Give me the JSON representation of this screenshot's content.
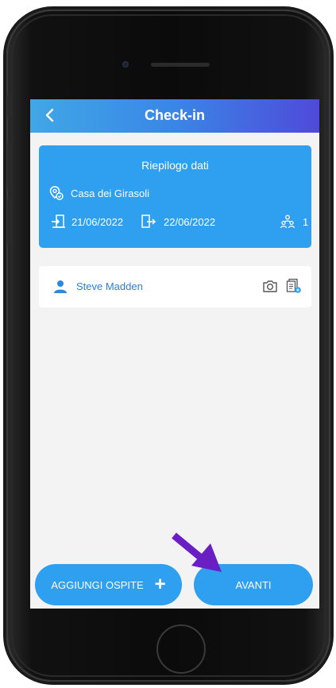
{
  "header": {
    "title": "Check-in",
    "back_icon": "chevron-left-icon"
  },
  "summary": {
    "heading": "Riepilogo dati",
    "property_name": "Casa dei Girasoli",
    "checkin_date": "21/06/2022",
    "checkout_date": "22/06/2022",
    "guest_count": "1"
  },
  "guests": [
    {
      "name": "Steve Madden"
    }
  ],
  "actions": {
    "add_guest_label": "AGGIUNGI OSPITE",
    "add_guest_icon": "+",
    "next_label": "AVANTI"
  },
  "colors": {
    "accent": "#2f9ff0",
    "header_gradient_start": "#40a7e6",
    "header_gradient_end": "#4f4ad9",
    "annotation_arrow": "#6a1fc4"
  }
}
